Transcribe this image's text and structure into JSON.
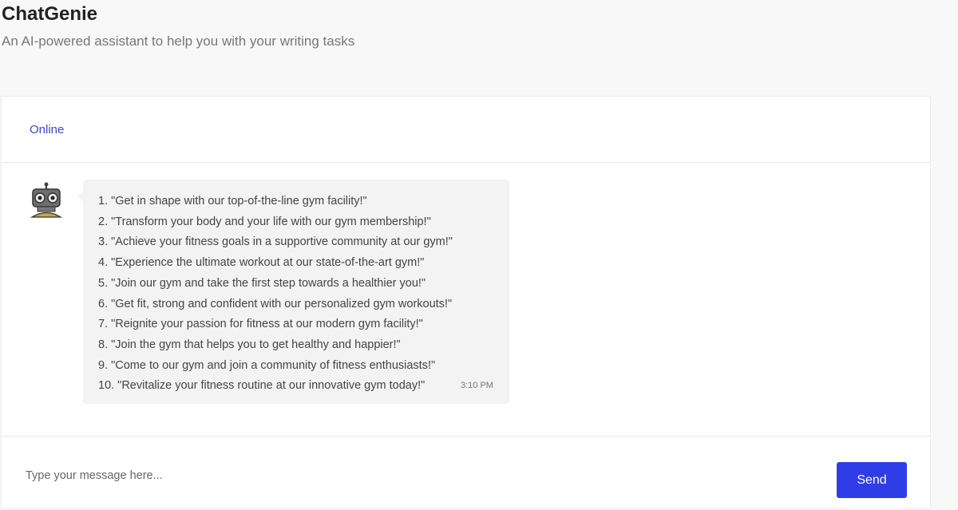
{
  "app": {
    "title": "ChatGenie",
    "subtitle": "An AI-powered assistant to help you with your writing tasks"
  },
  "chat": {
    "status": "Online",
    "bot_avatar_icon": "robot-icon",
    "messages": [
      {
        "lines": [
          "1. \"Get in shape with our top-of-the-line gym facility!\"",
          "2. \"Transform your body and your life with our gym membership!\"",
          "3. \"Achieve your fitness goals in a supportive community at our gym!\"",
          "4. \"Experience the ultimate workout at our state-of-the-art gym!\"",
          "5. \"Join our gym and take the first step towards a healthier you!\"",
          "6. \"Get fit, strong and confident with our personalized gym workouts!\"",
          "7. \"Reignite your passion for fitness at our modern gym facility!\"",
          "8. \"Join the gym that helps you to get healthy and happier!\"",
          "9. \"Come to our gym and join a community of fitness enthusiasts!\"",
          "10. \"Revitalize your fitness routine at our innovative gym today!\""
        ],
        "time": "3:10 PM"
      }
    ]
  },
  "composer": {
    "placeholder": "Type your message here...",
    "value": "",
    "send_label": "Send"
  },
  "colors": {
    "accent": "#2f3de6",
    "status": "#3848d8",
    "bubble": "#f3f3f3",
    "page_bg": "#f8f8f8"
  }
}
